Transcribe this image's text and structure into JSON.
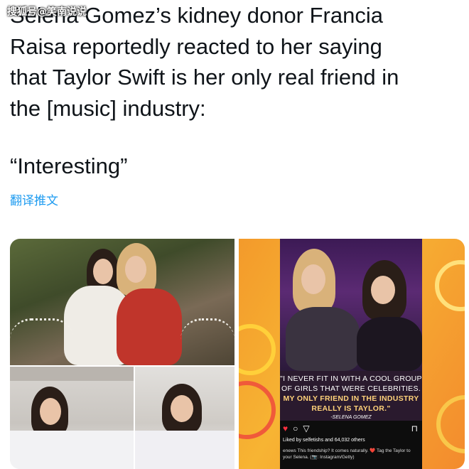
{
  "watermark": "搜狐号@笑南说说",
  "tweet": {
    "lines": [
      "Selena Gomez’s kidney donor Francia",
      "Raisa reportedly reacted to her saying",
      "that Taylor Swift is her only real friend in",
      "the [music] industry:"
    ],
    "quote": "“Interesting”",
    "translate_label": "翻译推文"
  },
  "media": {
    "quote_card": {
      "line1": "\"I NEVER FIT IN WITH A COOL GROUP",
      "line2": "OF GIRLS THAT WERE CELEBRITIES.",
      "line3": "MY ONLY FRIEND IN THE INDUSTRY",
      "line4": "REALLY IS TAYLOR.\"",
      "author": "-SELENA GOMEZ"
    },
    "instagram": {
      "likes": "Liked by selfetishs and 64,032 others",
      "caption": "enews This friendship? It comes naturally. ❤️ Tag the Taylor to your Selena. (📷: Instagram/Getty)"
    }
  },
  "colors": {
    "text": "#0f1419",
    "link": "#1d9bf0",
    "quote_bg": "#2a1a2e",
    "accent_orange": "#f39a2b"
  }
}
